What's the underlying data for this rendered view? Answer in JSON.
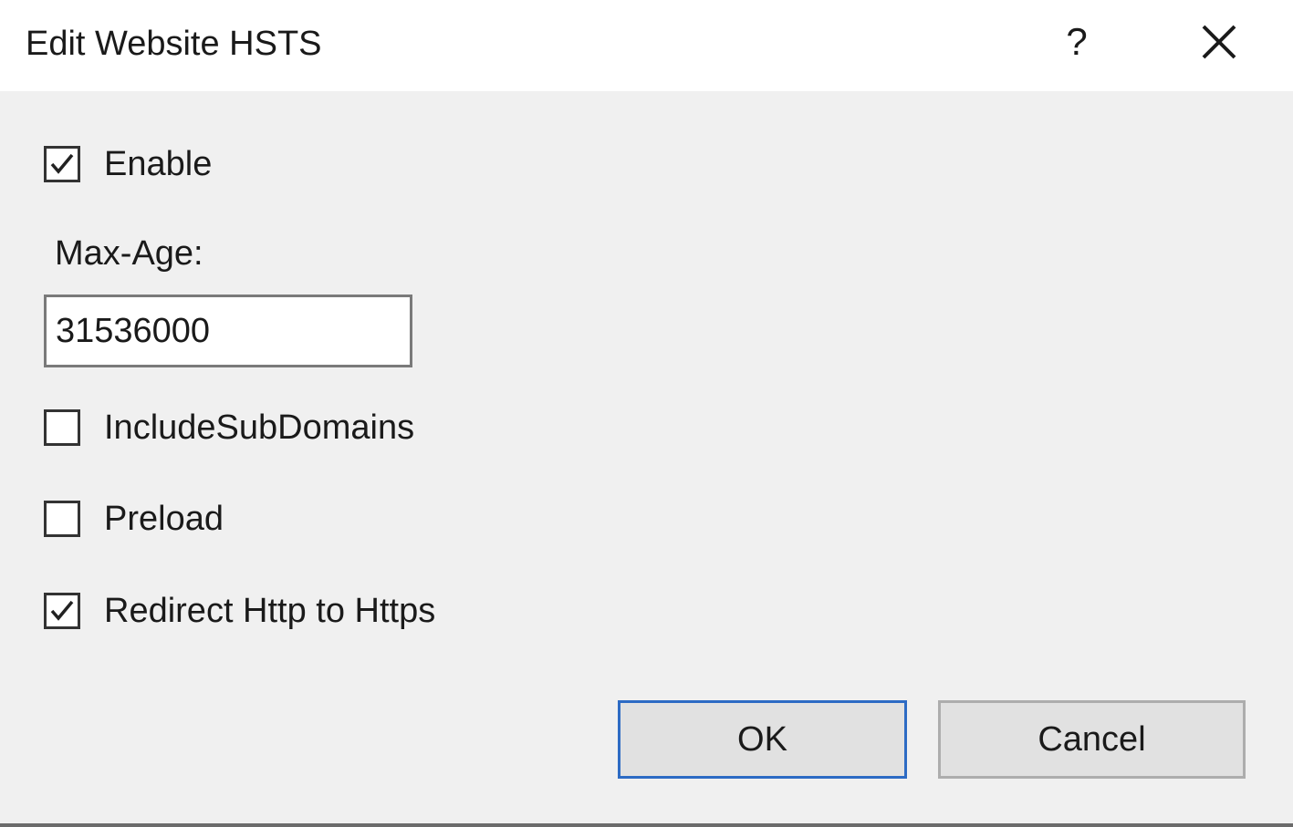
{
  "dialog": {
    "title": "Edit Website HSTS",
    "help_label": "?",
    "close_icon": "close-icon"
  },
  "form": {
    "enable": {
      "label": "Enable",
      "checked": true
    },
    "max_age": {
      "label": "Max-Age:",
      "value": "31536000"
    },
    "include_subdomains": {
      "label": "IncludeSubDomains",
      "checked": false
    },
    "preload": {
      "label": "Preload",
      "checked": false
    },
    "redirect_http": {
      "label": "Redirect Http to Https",
      "checked": true
    }
  },
  "buttons": {
    "ok_label": "OK",
    "cancel_label": "Cancel"
  },
  "colors": {
    "background": "#f0f0f0",
    "titlebar": "#ffffff",
    "default_button_border": "#2d6bc4"
  }
}
